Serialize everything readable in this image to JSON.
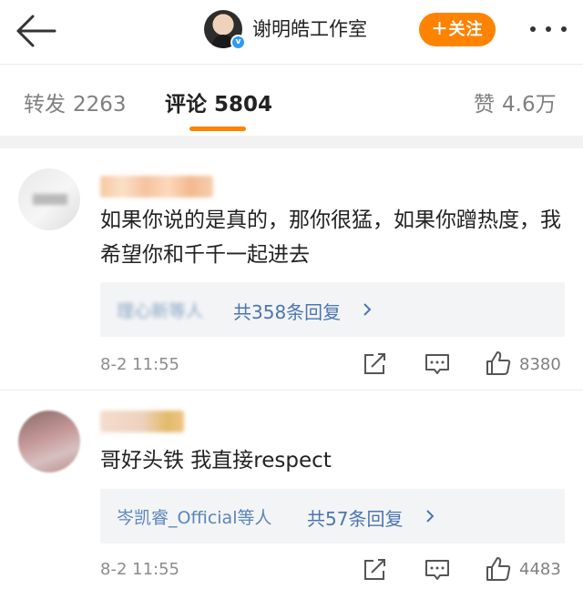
{
  "header": {
    "account_name": "谢明皓工作室",
    "follow_label": "＋关注"
  },
  "tabs": [
    {
      "label": "转发",
      "count": "2263"
    },
    {
      "label": "评论",
      "count": "5804"
    },
    {
      "label": "赞",
      "count": "4.6万"
    }
  ],
  "comments": [
    {
      "text": "如果你说的是真的，那你很猛，如果你蹭热度，我希望你和千千一起进去",
      "reply_users": "理心新等人",
      "reply_count": "共358条回复",
      "time": "8-2 11:55",
      "likes": "8380"
    },
    {
      "text": "哥好头铁 我直接respect",
      "reply_users": "岑凯睿_Official等人",
      "reply_count": "共57条回复",
      "time": "8-2 11:55",
      "likes": "4483"
    }
  ],
  "colors": {
    "accent": "#ff8200",
    "link": "#4a76b0",
    "verified": "#2f9bf0"
  }
}
